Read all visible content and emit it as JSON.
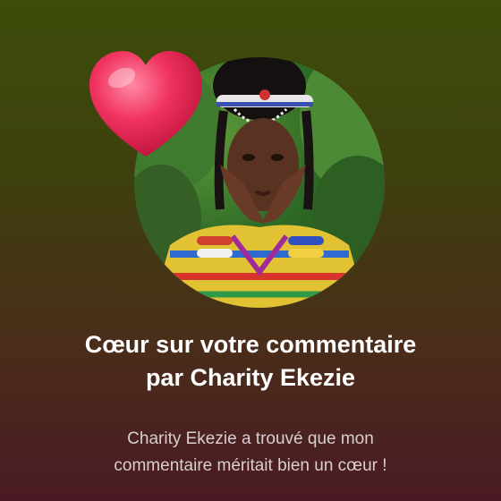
{
  "notification": {
    "title_line1": "Cœur sur votre commentaire",
    "title_line2": "par Charity Ekezie",
    "message_line1": "Charity Ekezie a trouvé que mon",
    "message_line2": "commentaire méritait bien un cœur !",
    "heart_color": "#e8285a",
    "text_color": "#ffffff"
  }
}
